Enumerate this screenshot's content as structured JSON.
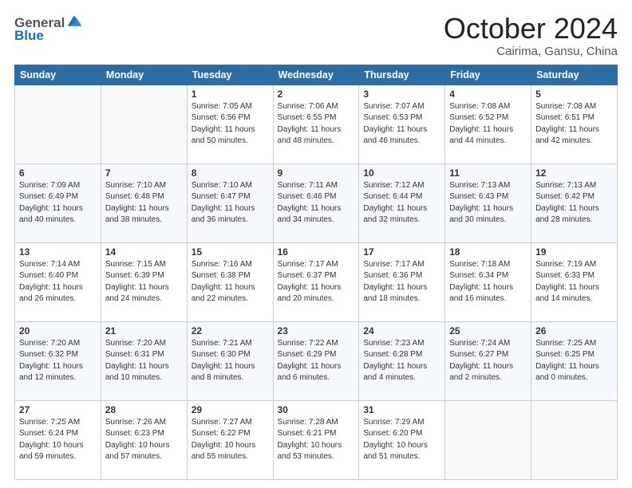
{
  "header": {
    "logo_general": "General",
    "logo_blue": "Blue",
    "month_title": "October 2024",
    "location": "Cairima, Gansu, China"
  },
  "days_of_week": [
    "Sunday",
    "Monday",
    "Tuesday",
    "Wednesday",
    "Thursday",
    "Friday",
    "Saturday"
  ],
  "weeks": [
    [
      {
        "day": "",
        "info": ""
      },
      {
        "day": "",
        "info": ""
      },
      {
        "day": "1",
        "info": "Sunrise: 7:05 AM\nSunset: 6:56 PM\nDaylight: 11 hours and 50 minutes."
      },
      {
        "day": "2",
        "info": "Sunrise: 7:06 AM\nSunset: 6:55 PM\nDaylight: 11 hours and 48 minutes."
      },
      {
        "day": "3",
        "info": "Sunrise: 7:07 AM\nSunset: 6:53 PM\nDaylight: 11 hours and 46 minutes."
      },
      {
        "day": "4",
        "info": "Sunrise: 7:08 AM\nSunset: 6:52 PM\nDaylight: 11 hours and 44 minutes."
      },
      {
        "day": "5",
        "info": "Sunrise: 7:08 AM\nSunset: 6:51 PM\nDaylight: 11 hours and 42 minutes."
      }
    ],
    [
      {
        "day": "6",
        "info": "Sunrise: 7:09 AM\nSunset: 6:49 PM\nDaylight: 11 hours and 40 minutes."
      },
      {
        "day": "7",
        "info": "Sunrise: 7:10 AM\nSunset: 6:48 PM\nDaylight: 11 hours and 38 minutes."
      },
      {
        "day": "8",
        "info": "Sunrise: 7:10 AM\nSunset: 6:47 PM\nDaylight: 11 hours and 36 minutes."
      },
      {
        "day": "9",
        "info": "Sunrise: 7:11 AM\nSunset: 6:46 PM\nDaylight: 11 hours and 34 minutes."
      },
      {
        "day": "10",
        "info": "Sunrise: 7:12 AM\nSunset: 6:44 PM\nDaylight: 11 hours and 32 minutes."
      },
      {
        "day": "11",
        "info": "Sunrise: 7:13 AM\nSunset: 6:43 PM\nDaylight: 11 hours and 30 minutes."
      },
      {
        "day": "12",
        "info": "Sunrise: 7:13 AM\nSunset: 6:42 PM\nDaylight: 11 hours and 28 minutes."
      }
    ],
    [
      {
        "day": "13",
        "info": "Sunrise: 7:14 AM\nSunset: 6:40 PM\nDaylight: 11 hours and 26 minutes."
      },
      {
        "day": "14",
        "info": "Sunrise: 7:15 AM\nSunset: 6:39 PM\nDaylight: 11 hours and 24 minutes."
      },
      {
        "day": "15",
        "info": "Sunrise: 7:16 AM\nSunset: 6:38 PM\nDaylight: 11 hours and 22 minutes."
      },
      {
        "day": "16",
        "info": "Sunrise: 7:17 AM\nSunset: 6:37 PM\nDaylight: 11 hours and 20 minutes."
      },
      {
        "day": "17",
        "info": "Sunrise: 7:17 AM\nSunset: 6:36 PM\nDaylight: 11 hours and 18 minutes."
      },
      {
        "day": "18",
        "info": "Sunrise: 7:18 AM\nSunset: 6:34 PM\nDaylight: 11 hours and 16 minutes."
      },
      {
        "day": "19",
        "info": "Sunrise: 7:19 AM\nSunset: 6:33 PM\nDaylight: 11 hours and 14 minutes."
      }
    ],
    [
      {
        "day": "20",
        "info": "Sunrise: 7:20 AM\nSunset: 6:32 PM\nDaylight: 11 hours and 12 minutes."
      },
      {
        "day": "21",
        "info": "Sunrise: 7:20 AM\nSunset: 6:31 PM\nDaylight: 11 hours and 10 minutes."
      },
      {
        "day": "22",
        "info": "Sunrise: 7:21 AM\nSunset: 6:30 PM\nDaylight: 11 hours and 8 minutes."
      },
      {
        "day": "23",
        "info": "Sunrise: 7:22 AM\nSunset: 6:29 PM\nDaylight: 11 hours and 6 minutes."
      },
      {
        "day": "24",
        "info": "Sunrise: 7:23 AM\nSunset: 6:28 PM\nDaylight: 11 hours and 4 minutes."
      },
      {
        "day": "25",
        "info": "Sunrise: 7:24 AM\nSunset: 6:27 PM\nDaylight: 11 hours and 2 minutes."
      },
      {
        "day": "26",
        "info": "Sunrise: 7:25 AM\nSunset: 6:25 PM\nDaylight: 11 hours and 0 minutes."
      }
    ],
    [
      {
        "day": "27",
        "info": "Sunrise: 7:25 AM\nSunset: 6:24 PM\nDaylight: 10 hours and 59 minutes."
      },
      {
        "day": "28",
        "info": "Sunrise: 7:26 AM\nSunset: 6:23 PM\nDaylight: 10 hours and 57 minutes."
      },
      {
        "day": "29",
        "info": "Sunrise: 7:27 AM\nSunset: 6:22 PM\nDaylight: 10 hours and 55 minutes."
      },
      {
        "day": "30",
        "info": "Sunrise: 7:28 AM\nSunset: 6:21 PM\nDaylight: 10 hours and 53 minutes."
      },
      {
        "day": "31",
        "info": "Sunrise: 7:29 AM\nSunset: 6:20 PM\nDaylight: 10 hours and 51 minutes."
      },
      {
        "day": "",
        "info": ""
      },
      {
        "day": "",
        "info": ""
      }
    ]
  ]
}
